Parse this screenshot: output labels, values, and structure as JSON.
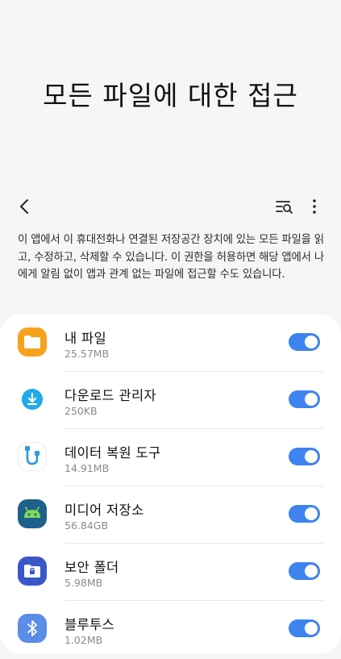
{
  "header": {
    "title": "모든 파일에 대한 접근"
  },
  "toolbar": {
    "back_icon": "back-arrow-icon",
    "search_icon": "filter-search-icon",
    "more_icon": "more-vertical-icon"
  },
  "description": "이 앱에서 이 휴대전화나 연결된 저장공간 장치에 있는 모든 파일을 읽고, 수정하고, 삭제할 수 있습니다. 이 권한을 허용하면 해당 앱에서 나에게 알림 없이 앱과 관계 없는 파일에 접근할 수도 있습니다.",
  "apps": [
    {
      "name": "내 파일",
      "size": "25.57MB",
      "icon": "folder-icon",
      "color": "#f6a21c",
      "enabled": true
    },
    {
      "name": "다운로드 관리자",
      "size": "250KB",
      "icon": "download-icon",
      "color": "#1fa9e8",
      "enabled": true
    },
    {
      "name": "데이터 복원 도구",
      "size": "14.91MB",
      "icon": "cable-icon",
      "color": "#2b9be0",
      "enabled": true
    },
    {
      "name": "미디어 저장소",
      "size": "56.84GB",
      "icon": "android-icon",
      "color": "#1e5f8b",
      "enabled": true
    },
    {
      "name": "보안 폴더",
      "size": "5.98MB",
      "icon": "secure-folder-icon",
      "color": "#3a56c8",
      "enabled": true
    },
    {
      "name": "블루투스",
      "size": "1.02MB",
      "icon": "bluetooth-icon",
      "color": "#5b8de8",
      "enabled": true
    }
  ],
  "colors": {
    "toggle_on": "#3e83f0",
    "background": "#f6f6f6",
    "card": "#ffffff"
  }
}
